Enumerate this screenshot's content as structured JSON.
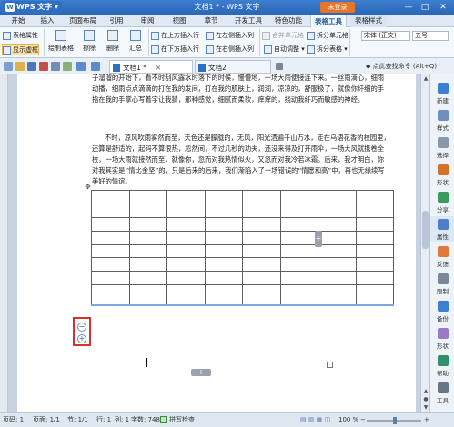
{
  "titlebar": {
    "app_name": "WPS 文字",
    "window_title": "文档1 * - WPS 文字",
    "not_logged_in": "未登录",
    "min_glyph": "—",
    "max_glyph": "□",
    "close_glyph": "✕"
  },
  "menu_tabs": [
    {
      "label": "开始"
    },
    {
      "label": "插入"
    },
    {
      "label": "页面布局"
    },
    {
      "label": "引用"
    },
    {
      "label": "审阅"
    },
    {
      "label": "视图"
    },
    {
      "label": "章节"
    },
    {
      "label": "开发工具"
    },
    {
      "label": "特色功能"
    },
    {
      "label": "表格工具"
    },
    {
      "label": "表格样式"
    }
  ],
  "ribbon": {
    "table_props": "表格属性",
    "show_gridlines": "显示虚框",
    "draw_table": "绘制表格",
    "erase": "擦除",
    "delete": "删除",
    "summary": "汇总",
    "insert_above": "在上方插入行",
    "insert_below": "在下方插入行",
    "insert_left": "在左侧插入列",
    "insert_right": "在右侧插入列",
    "merge_cells": "合并单元格",
    "split_cells": "拆分单元格",
    "split_table": "拆分表格",
    "autofit": "自动调整",
    "font_name": "宋体 (正文)",
    "font_size": "五号"
  },
  "doc_tabs": [
    {
      "label": "文档1 *"
    },
    {
      "label": "文档2"
    }
  ],
  "help_command": "点此查找命令 (Alt+Q)",
  "document": {
    "para1": "子溜溜的开始下，看不时刮风露水时落下的时候，慢慢地，一场大雨便接连下来。一丝雨滴心，细雨动播，细雨点点滴滴的打在我的发间，打在我的肌肤上，润润，凉凉的，舒服极了，就像你纤细的手指在我的手掌心写着字让我猜，那种感觉，细腻而柔软，痒痒的，挠动我纤巧而敏感的神经。",
    "para2": "不时，凉风吹雨雾然而至，天色还是朦胧的，无风，阳光洒遍千山万水，走在乌语花香的校园里，还算是舒适的，起码不算很热，忽然间，不过几秒的功夫，还没来得及打开雨伞，一场大风就携卷全校，一场大雨就接然而至，就像你，忽而对我热情似火，又忽而对我冷若冰霜。后来，我才明白，你对我其实是“情比金坚”的，只是后来的后来，我们渐陷入了一场错误的“情愿和高”中，再也无缘续写美好的情谊。"
  },
  "table": {
    "rows": 8,
    "cols": 8,
    "move_handle": "✥",
    "minus": "−",
    "plus": "+",
    "add_col": "+",
    "add_row": "+"
  },
  "taskpane": [
    {
      "label": "新建",
      "color": "#3d7fd1"
    },
    {
      "label": "样式",
      "color": "#6f8fbf"
    },
    {
      "label": "选择",
      "color": "#8a97a8"
    },
    {
      "label": "形状",
      "color": "#d0732b"
    },
    {
      "label": "分享",
      "color": "#3a9b5c"
    },
    {
      "label": "属性",
      "color": "#4f7fc9"
    },
    {
      "label": "反馈",
      "color": "#e07a3a"
    },
    {
      "label": "限制",
      "color": "#7a8796"
    },
    {
      "label": "备份",
      "color": "#3d7fd1"
    },
    {
      "label": "形状",
      "color": "#9a7ac4"
    },
    {
      "label": "帮助",
      "color": "#2f8f6f"
    },
    {
      "label": "工具",
      "color": "#6b7683"
    }
  ],
  "statusbar": {
    "pages": "页码: 1",
    "page_count": "页面: 1/1",
    "section": "节: 1/1",
    "row": "行: 1",
    "col": "列: 1",
    "word_count": "字数: 748",
    "spell_check": "拼写检查",
    "zoom": "100 %",
    "zoom_minus": "−",
    "zoom_plus": "+"
  },
  "colors": {
    "title_blue": "#2a66b5",
    "highlight_red": "#d8312b",
    "accent_orange": "#e8742a"
  }
}
